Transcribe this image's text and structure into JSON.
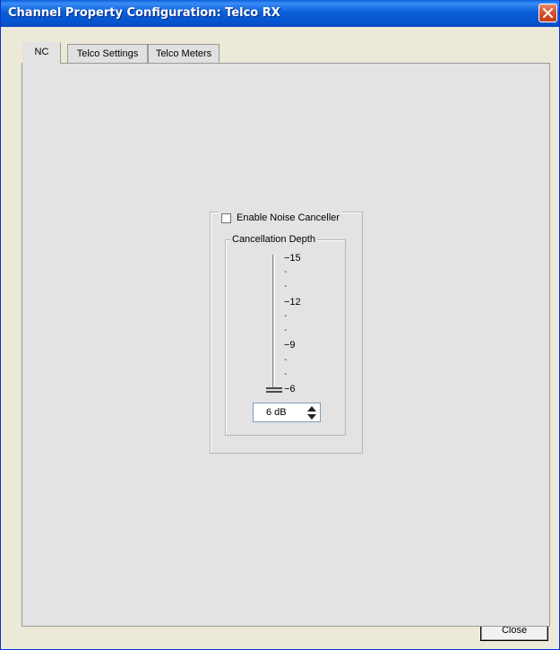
{
  "window": {
    "title": "Channel Property Configuration: Telco RX",
    "close_icon": "close-icon"
  },
  "tabs": [
    {
      "label": "NC",
      "active": true
    },
    {
      "label": "Telco Settings",
      "active": false
    },
    {
      "label": "Telco Meters",
      "active": false
    }
  ],
  "nc": {
    "enable_label": "Enable Noise Canceller",
    "enable_checked": false,
    "depth_group_label": "Cancellation Depth",
    "slider": {
      "major_ticks": [
        "−15",
        "−12",
        "−9",
        "−6"
      ],
      "minor_tick": "-",
      "value": 6
    },
    "spin_value": "6 dB"
  },
  "footer": {
    "close_label": "Close"
  },
  "colors": {
    "titlebar": "#0b5ed7",
    "panel": "#e3e3e3",
    "window": "#ece9d8"
  }
}
